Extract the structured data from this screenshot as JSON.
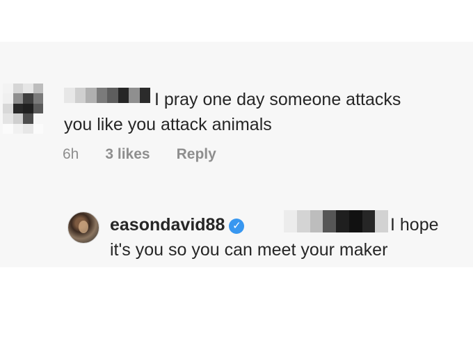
{
  "comment": {
    "text_line1": "I pray one day someone attacks",
    "text_line2": "you like you attack animals",
    "meta": {
      "time": "6h",
      "likes": "3 likes",
      "reply": "Reply"
    }
  },
  "reply": {
    "username": "easondavid88",
    "text_line1": "I hope",
    "text_line2": "it's you so you can meet your maker"
  },
  "icons": {
    "verified_icon": "check-badge",
    "avatar_icon": "profile-photo"
  }
}
